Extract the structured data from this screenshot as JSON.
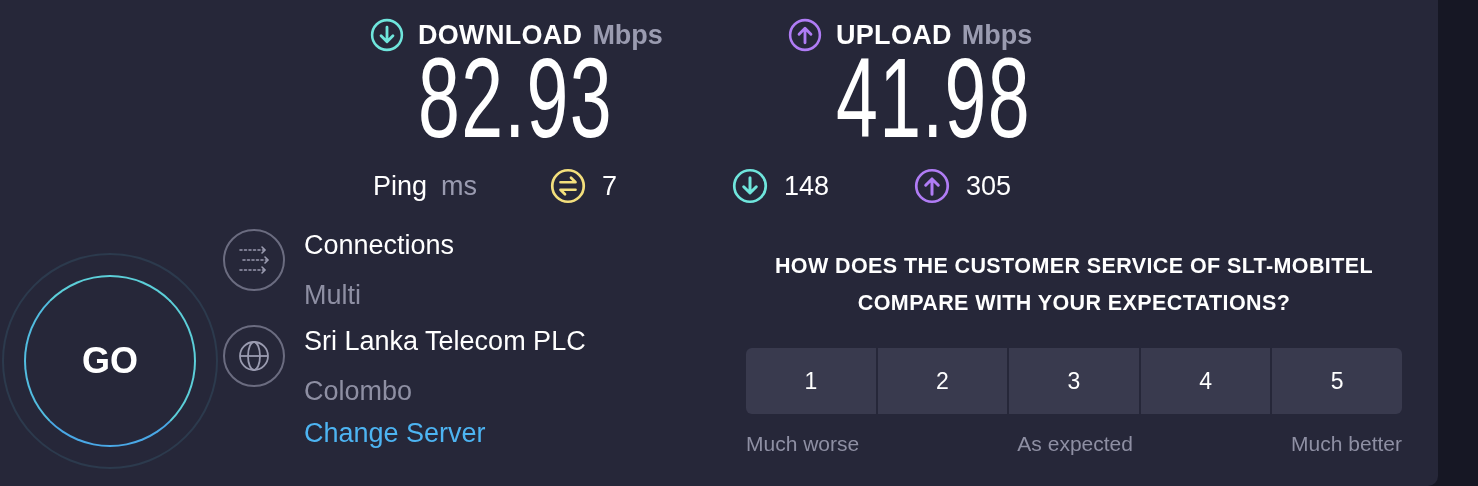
{
  "speeds": [
    {
      "kind": "download",
      "label": "DOWNLOAD",
      "unit": "Mbps",
      "value": "82.93"
    },
    {
      "kind": "upload",
      "label": "UPLOAD",
      "unit": "Mbps",
      "value": "41.98"
    }
  ],
  "ping": {
    "label": "Ping",
    "unit": "ms",
    "items": [
      {
        "kind": "idle",
        "value": "7"
      },
      {
        "kind": "download",
        "value": "148"
      },
      {
        "kind": "upload",
        "value": "305"
      }
    ]
  },
  "go_button": "GO",
  "server_info": [
    {
      "kind": "connections",
      "title": "Connections",
      "subtitle": "Multi"
    },
    {
      "kind": "server",
      "title": "Sri Lanka Telecom PLC",
      "subtitle": "Colombo",
      "link": "Change Server"
    }
  ],
  "survey": {
    "question": "HOW DOES THE CUSTOMER SERVICE OF SLT-MOBITEL COMPARE WITH YOUR EXPECTATIONS?",
    "options": [
      {
        "label": "1",
        "selected": false
      },
      {
        "label": "2",
        "selected": false
      },
      {
        "label": "3",
        "selected": false
      },
      {
        "label": "4",
        "selected": false
      },
      {
        "label": "5",
        "selected": false
      }
    ],
    "scale_labels": [
      "Much worse",
      "As expected",
      "Much better"
    ]
  }
}
